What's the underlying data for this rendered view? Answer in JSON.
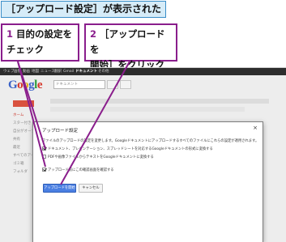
{
  "caption": "［アップロード設定］が表示された",
  "callouts": [
    {
      "number": "1",
      "text_line1": "目的の設定を",
      "text_line2": "チェック"
    },
    {
      "number": "2",
      "text_line1": "［アップロードを",
      "text_line2": "開始］をクリック"
    }
  ],
  "app": {
    "topbar_items": [
      "ウェブ",
      "画像",
      "動画",
      "地図",
      "ニュース",
      "翻訳",
      "Gmail",
      "ドキュメント",
      "その他"
    ],
    "logo_letters": [
      "G",
      "o",
      "o",
      "g",
      "l",
      "e"
    ],
    "search_value": "ドキュメント",
    "sidebar": {
      "items": [
        "ホーム",
        "スター付き",
        "自分がオーナー",
        "共有",
        "最近",
        "すべてのアイテム",
        "ゴミ箱",
        "フォルダ"
      ]
    }
  },
  "dialog": {
    "title": "アップロード設定",
    "close_glyph": "×",
    "description": "ファイルのアップロードの設定を変更します。Googleドキュメントにアップロードするすべてのファイルにこれらの設定が適用されます。",
    "description_link": "詳細",
    "options": [
      {
        "label": "ドキュメント、プレゼンテーション、スプレッドシートを対応するGoogleドキュメントの形式に変換する",
        "checked": true
      },
      {
        "label": "PDFや画像ファイルからテキストをGoogleドキュメントに変換する",
        "checked": false
      },
      {
        "label": "アップロード前にこの確認画面を確認する",
        "checked": true
      }
    ],
    "start_button": "アップロードを開始",
    "cancel_button": "キャンセル"
  },
  "colors": {
    "accent": "#8a1e8c",
    "caption_bg": "#d6ecf8",
    "primary_button": "#4a7fe2"
  }
}
